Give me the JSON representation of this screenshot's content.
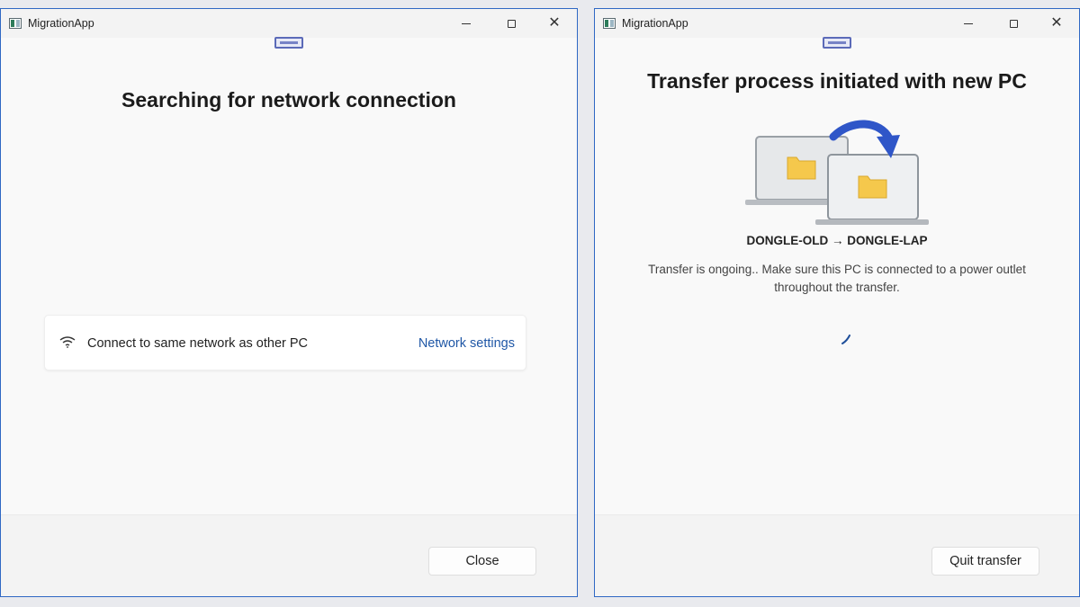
{
  "left_window": {
    "title": "MigrationApp",
    "heading": "Searching for network connection",
    "network_card": {
      "icon": "wifi-icon",
      "message": "Connect to same network as other PC",
      "link_label": "Network settings"
    },
    "close_button_label": "Close"
  },
  "right_window": {
    "title": "MigrationApp",
    "heading": "Transfer process initiated with new PC",
    "route": "DONGLE-OLD → DONGLE-LAP",
    "status_line_1": "Transfer is ongoing.. Make sure this PC is connected to a power outlet",
    "status_line_2": "throughout the transfer.",
    "quit_button_label": "Quit transfer"
  },
  "colors": {
    "accent_border": "#2f68c4",
    "link": "#1f57a6",
    "arrow": "#2f56c8",
    "folder": "#f5c84c",
    "device_icon": "#5b6ab8"
  }
}
